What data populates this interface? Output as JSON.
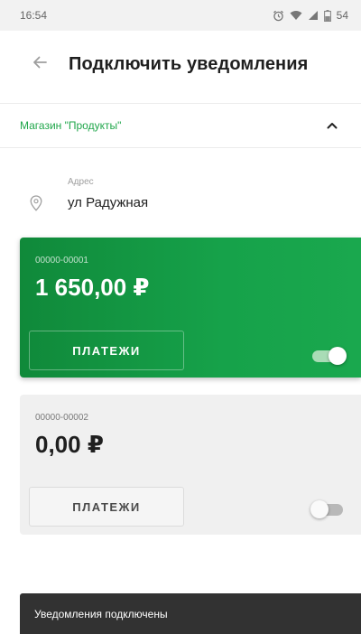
{
  "status_bar": {
    "time": "16:54",
    "battery_level": "54",
    "icons": [
      "alarm-icon",
      "wifi-icon",
      "signal-icon",
      "battery-icon"
    ]
  },
  "header": {
    "back_icon": "arrow-left-icon",
    "title": "Подключить уведомления"
  },
  "shop": {
    "name": "Магазин \"Продукты\"",
    "toggle_icon": "chevron-up-icon"
  },
  "address": {
    "label": "Адрес",
    "value": "ул Радужная",
    "icon": "location-pin-icon"
  },
  "accounts": [
    {
      "number": "00000-00001",
      "amount": "1 650,00 ₽",
      "button_label": "ПЛАТЕЖИ",
      "notifications_enabled": true
    },
    {
      "number": "00000-00002",
      "amount": "0,00 ₽",
      "button_label": "ПЛАТЕЖИ",
      "notifications_enabled": false
    }
  ],
  "snackbar": {
    "message": "Уведомления подключены"
  },
  "colors": {
    "accent_green": "#16a24a",
    "shop_link_green": "#1fa64a",
    "snackbar_bg": "#323232",
    "inactive_card_bg": "#f0f0f0"
  }
}
